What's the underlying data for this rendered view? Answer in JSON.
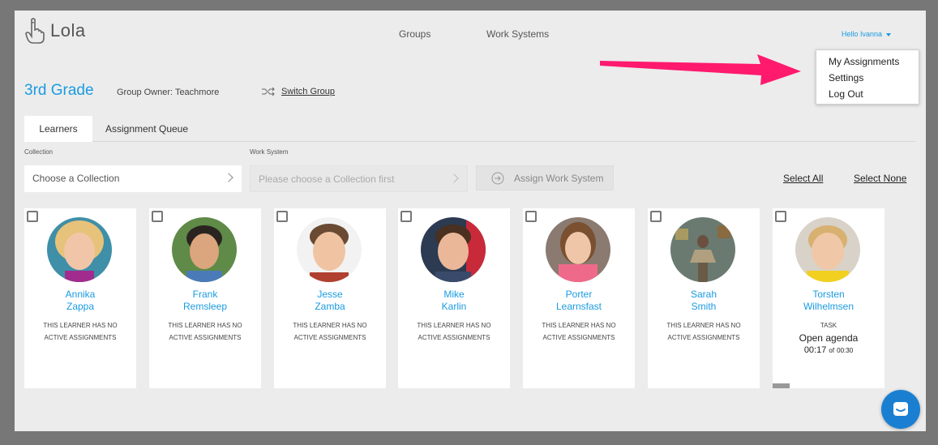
{
  "header": {
    "logo_text": "Lola",
    "nav": {
      "groups": "Groups",
      "work_systems": "Work Systems"
    },
    "user_greeting": "Hello Ivanna"
  },
  "user_menu": {
    "items": [
      "My Assignments",
      "Settings",
      "Log Out"
    ]
  },
  "group": {
    "name": "3rd Grade",
    "owner": "Group Owner: Teachmore",
    "switch_label": "Switch Group"
  },
  "tabs": [
    {
      "label": "Learners",
      "active": true
    },
    {
      "label": "Assignment Queue",
      "active": false
    }
  ],
  "filters": {
    "collection_label": "Collection",
    "collection_value": "Choose a Collection",
    "work_system_label": "Work System",
    "work_system_placeholder": "Please choose a Collection first",
    "assign_button": "Assign Work System",
    "select_all": "Select All",
    "select_none": "Select None"
  },
  "learners": [
    {
      "first": "Annika",
      "last": "Zappa",
      "status1": "THIS LEARNER HAS NO",
      "status2": "ACTIVE ASSIGNMENTS"
    },
    {
      "first": "Frank",
      "last": "Remsleep",
      "status1": "THIS LEARNER HAS NO",
      "status2": "ACTIVE ASSIGNMENTS"
    },
    {
      "first": "Jesse",
      "last": "Zamba",
      "status1": "THIS LEARNER HAS NO",
      "status2": "ACTIVE ASSIGNMENTS"
    },
    {
      "first": "Mike",
      "last": "Karlin",
      "status1": "THIS LEARNER HAS NO",
      "status2": "ACTIVE ASSIGNMENTS"
    },
    {
      "first": "Porter",
      "last": "Learnsfast",
      "status1": "THIS LEARNER HAS NO",
      "status2": "ACTIVE ASSIGNMENTS"
    },
    {
      "first": "Sarah",
      "last": "Smith",
      "status1": "THIS LEARNER HAS NO",
      "status2": "ACTIVE ASSIGNMENTS"
    },
    {
      "first": "Torsten",
      "last": "Wilhelmsen",
      "task_label": "TASK",
      "task_name": "Open agenda",
      "elapsed": "00:17",
      "of_label": "of",
      "duration": "00:30"
    }
  ],
  "colors": {
    "accent": "#1a9be0",
    "arrow": "#ff1a6e",
    "chat_button": "#1a7fd1"
  },
  "icons": {
    "logo": "hand-pointing-icon",
    "switch": "shuffle-icon",
    "assign": "arrow-circle-icon",
    "chat": "chat-bubble-icon"
  }
}
